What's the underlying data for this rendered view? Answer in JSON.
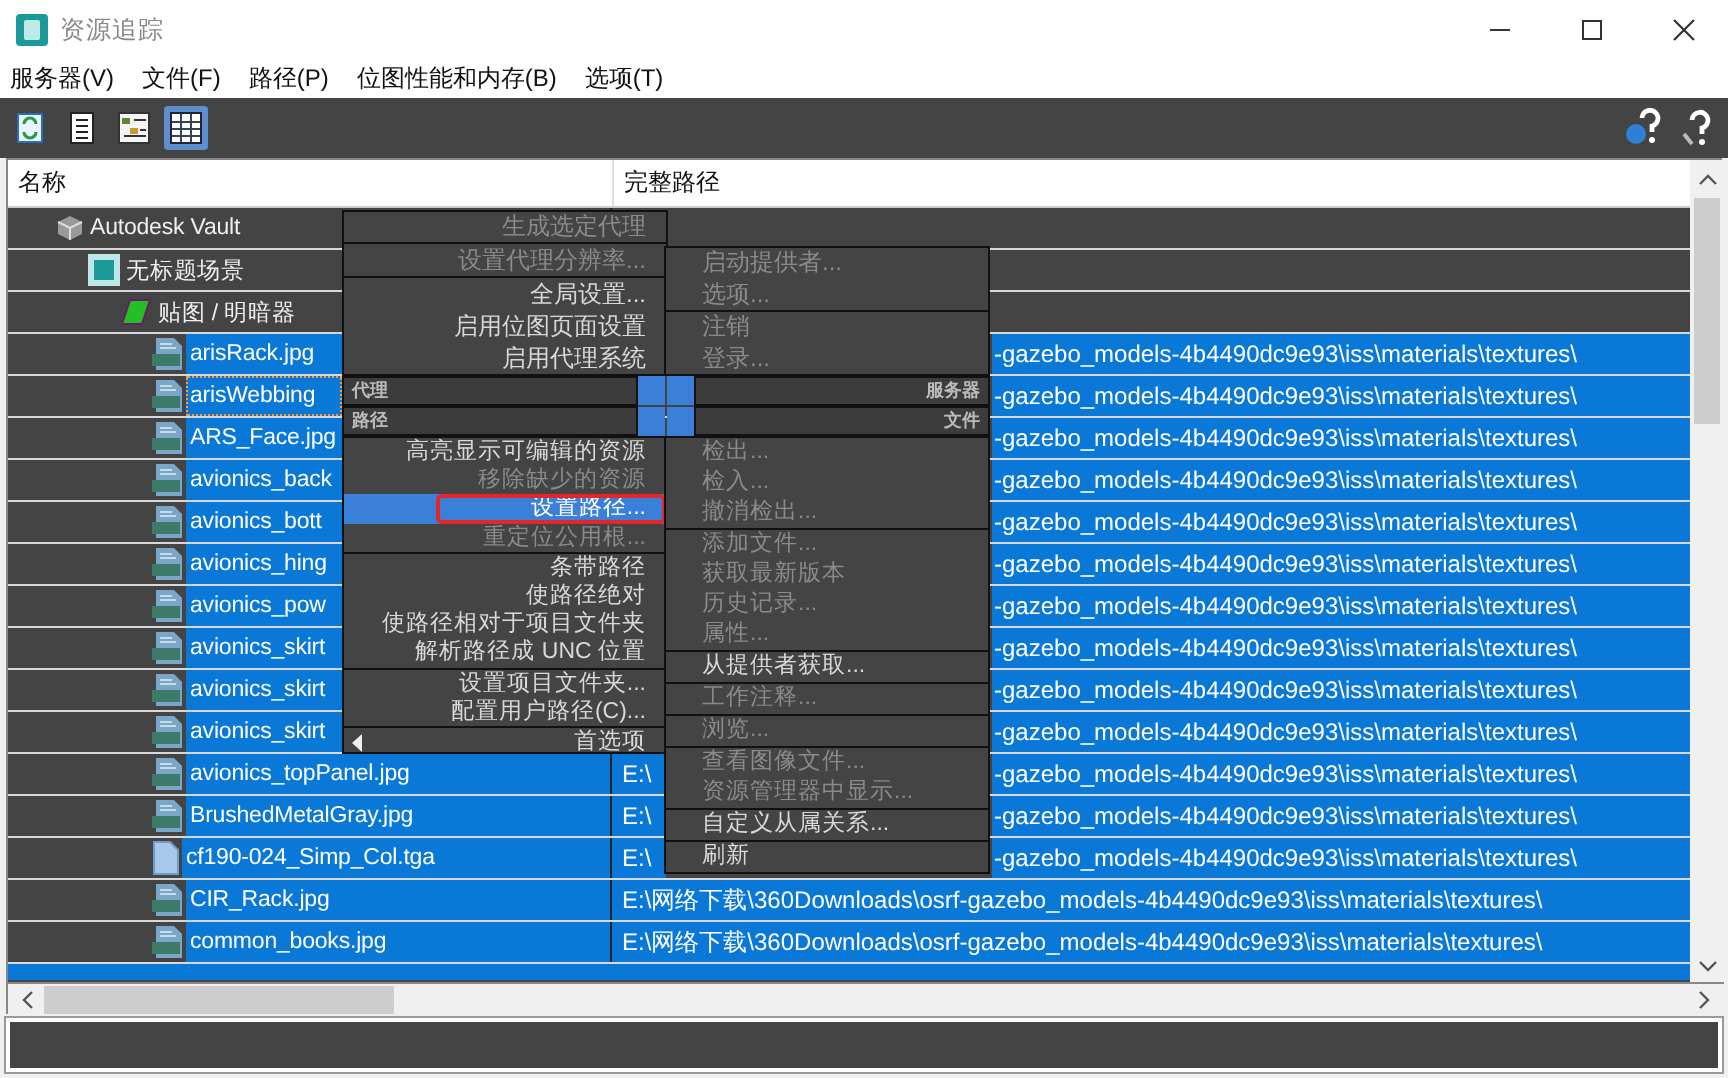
{
  "window": {
    "title": "资源追踪"
  },
  "menu_bar": [
    "服务器(V)",
    "文件(F)",
    "路径(P)",
    "位图性能和内存(B)",
    "选项(T)"
  ],
  "toolbar": {
    "left": [
      {
        "kind": "refresh",
        "selected": false
      },
      {
        "kind": "list",
        "selected": false
      },
      {
        "kind": "tree",
        "selected": false
      },
      {
        "kind": "grid",
        "selected": true
      }
    ],
    "right": [
      {
        "kind": "web_help"
      },
      {
        "kind": "help"
      }
    ]
  },
  "table": {
    "columns": [
      "名称",
      "完整路径"
    ],
    "rows": [
      {
        "name": "Autodesk Vault",
        "kind": "vault",
        "selected": false,
        "focused": false,
        "children": [
          {
            "name": "无标题场景",
            "kind": "scene",
            "selected": false,
            "focused": false,
            "children": [
              {
                "name": "贴图 / 明暗器",
                "kind": "maps",
                "selected": false,
                "focused": false,
                "children": [
                  {
                    "name": "arisRack.jpg",
                    "kind": "jpg",
                    "selected": true,
                    "focused": false,
                    "path_end": "-gazebo_models-4b4490dc9e93\\iss\\materials\\textures\\"
                  },
                  {
                    "name": "arisWebbing",
                    "kind": "jpg",
                    "selected": true,
                    "focused": true,
                    "path_end": "-gazebo_models-4b4490dc9e93\\iss\\materials\\textures\\"
                  },
                  {
                    "name": "ARS_Face.jpg",
                    "kind": "jpg",
                    "selected": true,
                    "focused": false,
                    "path_end": "-gazebo_models-4b4490dc9e93\\iss\\materials\\textures\\"
                  },
                  {
                    "name": "avionics_back",
                    "kind": "jpg",
                    "selected": true,
                    "focused": false,
                    "path_end": "-gazebo_models-4b4490dc9e93\\iss\\materials\\textures\\"
                  },
                  {
                    "name": "avionics_bott",
                    "kind": "jpg",
                    "selected": true,
                    "focused": false,
                    "path_end": "-gazebo_models-4b4490dc9e93\\iss\\materials\\textures\\"
                  },
                  {
                    "name": "avionics_hing",
                    "kind": "jpg",
                    "selected": true,
                    "focused": false,
                    "path_end": "-gazebo_models-4b4490dc9e93\\iss\\materials\\textures\\"
                  },
                  {
                    "name": "avionics_pow",
                    "kind": "jpg",
                    "selected": true,
                    "focused": false,
                    "path_end": "-gazebo_models-4b4490dc9e93\\iss\\materials\\textures\\"
                  },
                  {
                    "name": "avionics_skirt",
                    "kind": "jpg",
                    "selected": true,
                    "focused": false,
                    "path_end": "-gazebo_models-4b4490dc9e93\\iss\\materials\\textures\\"
                  },
                  {
                    "name": "avionics_skirt",
                    "kind": "jpg",
                    "selected": true,
                    "focused": false,
                    "path_end": "-gazebo_models-4b4490dc9e93\\iss\\materials\\textures\\"
                  },
                  {
                    "name": "avionics_skirt",
                    "kind": "jpg",
                    "selected": true,
                    "focused": false,
                    "path_end": "-gazebo_models-4b4490dc9e93\\iss\\materials\\textures\\"
                  },
                  {
                    "name": "avionics_topPanel.jpg",
                    "kind": "jpg",
                    "selected": true,
                    "focused": false,
                    "path_start": "E:\\",
                    "path_end": "-gazebo_models-4b4490dc9e93\\iss\\materials\\textures\\"
                  },
                  {
                    "name": "BrushedMetalGray.jpg",
                    "kind": "jpg",
                    "selected": true,
                    "focused": false,
                    "path_start": "E:\\",
                    "path_end": "-gazebo_models-4b4490dc9e93\\iss\\materials\\textures\\"
                  },
                  {
                    "name": "cf190-024_Simp_Col.tga",
                    "kind": "file",
                    "selected": true,
                    "focused": false,
                    "path_start": "E:\\",
                    "path_end": "-gazebo_models-4b4490dc9e93\\iss\\materials\\textures\\"
                  },
                  {
                    "name": "CIR_Rack.jpg",
                    "kind": "jpg",
                    "selected": true,
                    "focused": false,
                    "path": "E:\\网络下载\\360Downloads\\osrf-gazebo_models-4b4490dc9e93\\iss\\materials\\textures\\"
                  },
                  {
                    "name": "common_books.jpg",
                    "kind": "jpg",
                    "selected": true,
                    "focused": false,
                    "path": "E:\\网络下载\\360Downloads\\osrf-gazebo_models-4b4490dc9e93\\iss\\materials\\textures\\"
                  }
                ]
              }
            ]
          }
        ]
      }
    ]
  },
  "quad_menu": {
    "top_left": {
      "title": "代理",
      "groups": [
        [
          {
            "label": "生成选定代理",
            "disabled": true,
            "selected": false,
            "marked": false,
            "submenu": false
          }
        ],
        [
          {
            "label": "设置代理分辨率...",
            "disabled": true,
            "selected": false,
            "marked": false,
            "submenu": false
          }
        ],
        [
          {
            "label": "全局设置...",
            "disabled": false,
            "selected": false,
            "marked": false,
            "submenu": false
          },
          {
            "label": "启用位图页面设置",
            "disabled": false,
            "selected": false,
            "marked": false,
            "submenu": false
          },
          {
            "label": "启用代理系统",
            "disabled": false,
            "selected": false,
            "marked": false,
            "submenu": false
          }
        ]
      ]
    },
    "top_right": {
      "title": "服务器",
      "groups": [
        [
          {
            "label": "启动提供者...",
            "disabled": true,
            "selected": false,
            "marked": false,
            "submenu": false
          },
          {
            "label": "选项...",
            "disabled": true,
            "selected": false,
            "marked": false,
            "submenu": false
          }
        ],
        [
          {
            "label": "注销",
            "disabled": true,
            "selected": false,
            "marked": false,
            "submenu": false
          },
          {
            "label": "登录...",
            "disabled": true,
            "selected": false,
            "marked": false,
            "submenu": false
          }
        ]
      ]
    },
    "bottom_left": {
      "title": "路径",
      "groups": [
        [
          {
            "label": "高亮显示可编辑的资源",
            "disabled": false,
            "selected": false,
            "marked": false,
            "submenu": false
          },
          {
            "label": "移除缺少的资源",
            "disabled": true,
            "selected": false,
            "marked": false,
            "submenu": false
          },
          {
            "label": "设置路径...",
            "disabled": false,
            "selected": true,
            "marked": true,
            "submenu": false
          },
          {
            "label": "重定位公用根...",
            "disabled": true,
            "selected": false,
            "marked": false,
            "submenu": false
          }
        ],
        [
          {
            "label": "条带路径",
            "disabled": false,
            "selected": false,
            "marked": false,
            "submenu": false
          },
          {
            "label": "使路径绝对",
            "disabled": false,
            "selected": false,
            "marked": false,
            "submenu": false
          },
          {
            "label": "使路径相对于项目文件夹",
            "disabled": false,
            "selected": false,
            "marked": false,
            "submenu": false
          },
          {
            "label": "解析路径成 UNC 位置",
            "disabled": false,
            "selected": false,
            "marked": false,
            "submenu": false
          }
        ],
        [
          {
            "label": "设置项目文件夹...",
            "disabled": false,
            "selected": false,
            "marked": false,
            "submenu": false
          },
          {
            "label": "配置用户路径(C)...",
            "disabled": false,
            "selected": false,
            "marked": false,
            "submenu": false
          }
        ],
        [
          {
            "label": "首选项",
            "disabled": false,
            "selected": false,
            "marked": false,
            "submenu": true
          }
        ]
      ]
    },
    "bottom_right": {
      "title": "文件",
      "groups": [
        [
          {
            "label": "检出...",
            "disabled": true,
            "selected": false,
            "marked": false,
            "submenu": false
          },
          {
            "label": "检入...",
            "disabled": true,
            "selected": false,
            "marked": false,
            "submenu": false
          },
          {
            "label": "撤消检出...",
            "disabled": true,
            "selected": false,
            "marked": false,
            "submenu": false
          }
        ],
        [
          {
            "label": "添加文件...",
            "disabled": true,
            "selected": false,
            "marked": false,
            "submenu": false
          },
          {
            "label": "获取最新版本",
            "disabled": true,
            "selected": false,
            "marked": false,
            "submenu": false
          },
          {
            "label": "历史记录...",
            "disabled": true,
            "selected": false,
            "marked": false,
            "submenu": false
          },
          {
            "label": "属性...",
            "disabled": true,
            "selected": false,
            "marked": false,
            "submenu": false
          }
        ],
        [
          {
            "label": "从提供者获取...",
            "disabled": false,
            "selected": false,
            "marked": false,
            "submenu": false
          }
        ],
        [
          {
            "label": "工作注释...",
            "disabled": true,
            "selected": false,
            "marked": false,
            "submenu": false
          }
        ],
        [
          {
            "label": "浏览...",
            "disabled": true,
            "selected": false,
            "marked": false,
            "submenu": false
          }
        ],
        [
          {
            "label": "查看图像文件...",
            "disabled": true,
            "selected": false,
            "marked": false,
            "submenu": false
          },
          {
            "label": "资源管理器中显示...",
            "disabled": true,
            "selected": false,
            "marked": false,
            "submenu": false
          }
        ],
        [
          {
            "label": "自定义从属关系...",
            "disabled": false,
            "selected": false,
            "marked": false,
            "submenu": false
          }
        ],
        [
          {
            "label": "刷新",
            "disabled": false,
            "selected": false,
            "marked": false,
            "submenu": false
          }
        ]
      ]
    }
  }
}
